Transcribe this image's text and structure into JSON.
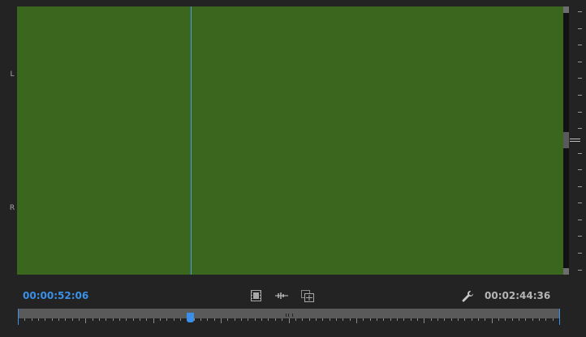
{
  "channels": {
    "left_label": "L",
    "right_label": "R"
  },
  "colors": {
    "waveform_fill": "#3b661e",
    "playhead": "#4b9be8",
    "current_timecode": "#3a90e8",
    "duration_timecode": "#b5b5b5"
  },
  "timecode": {
    "current": "00:00:52:06",
    "duration": "00:02:44:36"
  },
  "playback": {
    "position_fraction": 0.318
  },
  "controls": {
    "video_icon": "film-strip-icon",
    "audio_icon": "audio-waveform-icon",
    "export_icon": "export-frame-icon",
    "settings_icon": "wrench-icon"
  }
}
